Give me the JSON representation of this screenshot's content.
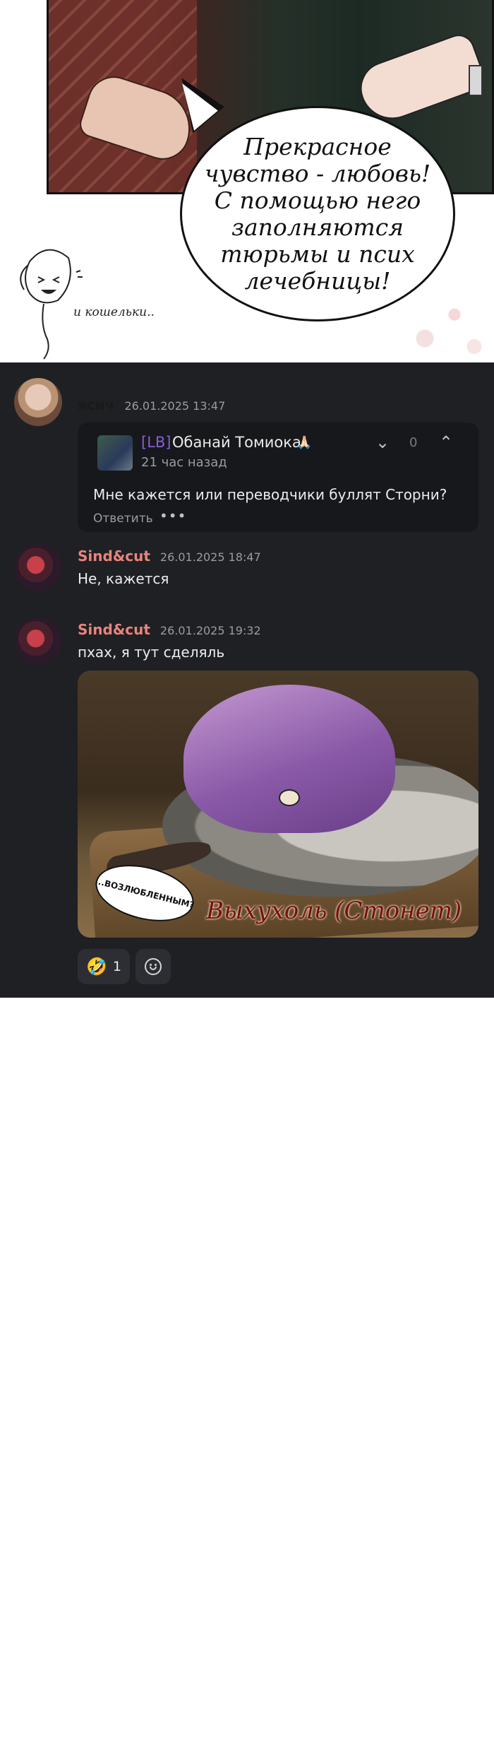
{
  "manga": {
    "speech_bubble": "Прекрасное чувство - любовь! С помощью него заполняются тюрьмы и псих лечебницы!",
    "side_caption": "и кошельки.."
  },
  "comments": [
    {
      "author": "ясич",
      "timestamp": "26.01.2025 13:47",
      "quote": {
        "tag": "[LB]",
        "name": "Обанай Томиока",
        "name_emoji": "🙏🏻",
        "time_ago": "21 час назад",
        "vote_count": "0",
        "text": "Мне кажется или переводчики буллят Сторни?",
        "reply_label": "Ответить",
        "more_label": "•••"
      }
    },
    {
      "author": "Sind&cut",
      "timestamp": "26.01.2025 18:47",
      "text": "Не, кажется"
    },
    {
      "author": "Sind&cut",
      "timestamp": "26.01.2025 19:32",
      "text": "пхах, я тут сделяль",
      "image": {
        "bubble_text": "...ВОЗЛЮБЛЕННЫМ?",
        "caption": "Выхухоль (Стонет)"
      },
      "reactions": [
        {
          "emoji": "🤣",
          "count": "1"
        }
      ]
    }
  ],
  "colors": {
    "background": "#1e2024",
    "author_accent": "#e8847c",
    "tag_purple": "#8a5cd6"
  }
}
